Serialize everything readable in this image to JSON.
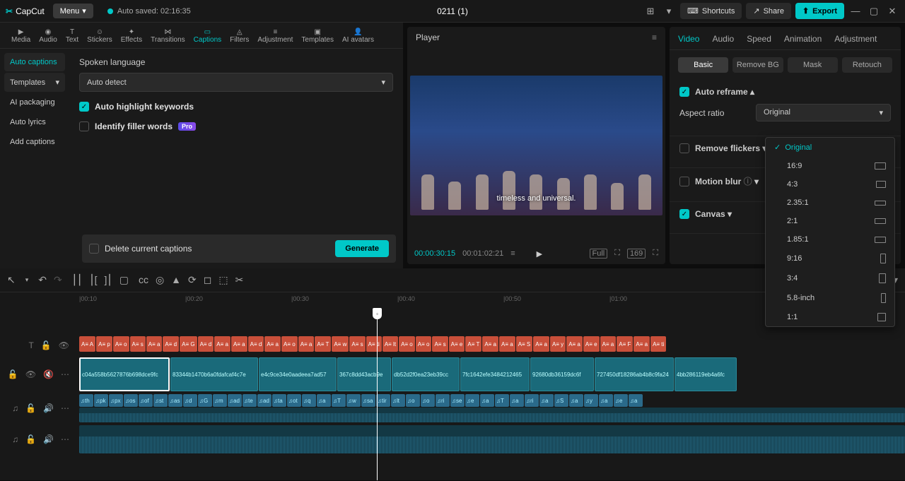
{
  "titlebar": {
    "app": "CapCut",
    "menu": "Menu",
    "autosave": "Auto saved: 02:16:35",
    "project": "0211 (1)",
    "shortcuts": "Shortcuts",
    "share": "Share",
    "export": "Export"
  },
  "toolbar": {
    "media": "Media",
    "audio": "Audio",
    "text": "Text",
    "stickers": "Stickers",
    "effects": "Effects",
    "transitions": "Transitions",
    "captions": "Captions",
    "filters": "Filters",
    "adjustment": "Adjustment",
    "templates": "Templates",
    "avatars": "AI avatars"
  },
  "sidebar": {
    "auto_captions": "Auto captions",
    "templates": "Templates",
    "ai_packaging": "AI packaging",
    "auto_lyrics": "Auto lyrics",
    "add_captions": "Add captions"
  },
  "captions_panel": {
    "lang_label": "Spoken language",
    "lang_value": "Auto detect",
    "highlight": "Auto highlight keywords",
    "filler": "Identify filler words",
    "pro": "Pro",
    "delete": "Delete current captions",
    "generate": "Generate"
  },
  "player": {
    "title": "Player",
    "subtitle": "timeless and universal.",
    "time_cur": "00:00:30:15",
    "time_dur": "00:01:02:21",
    "full": "Full",
    "fit_btn": "169"
  },
  "right": {
    "tabs": {
      "video": "Video",
      "audio": "Audio",
      "speed": "Speed",
      "animation": "Animation",
      "adjustment": "Adjustment"
    },
    "subtabs": {
      "basic": "Basic",
      "removebg": "Remove BG",
      "mask": "Mask",
      "retouch": "Retouch"
    },
    "auto_reframe": "Auto reframe",
    "aspect_label": "Aspect ratio",
    "aspect_value": "Original",
    "remove_flickers": "Remove flickers",
    "motion_blur": "Motion blur",
    "canvas": "Canvas",
    "ratios": [
      "Original",
      "16:9",
      "4:3",
      "2.35:1",
      "2:1",
      "1.85:1",
      "9:16",
      "3:4",
      "5.8-inch",
      "1:1"
    ]
  },
  "timeline": {
    "marks": [
      "00:10",
      "00:20",
      "00:30",
      "00:40",
      "00:50",
      "01:00"
    ],
    "clips": [
      "c04a558b5627876b698dce9fc",
      "83344b1470b6a0fdafcaf4c7e",
      "e4c9ce34e0aadeea7ad57",
      "367c8dd43acb9e",
      "db52d2f0ea23eb39cc",
      "7fc1642efe3484212465",
      "92680db36159dc6f",
      "727450df18286ab4b8c9fa24",
      "4bb286119eb4a6fc"
    ],
    "caption_letters": [
      "A",
      "p",
      "o",
      "s",
      "a",
      "d",
      "G",
      "d",
      "a",
      "a",
      "d",
      "a",
      "o",
      "a",
      "T",
      "w",
      "s",
      "ti",
      "lt",
      "o",
      "o",
      "s",
      "e",
      "T",
      "a",
      "a",
      "S",
      "a",
      "y",
      "a",
      "e",
      "a",
      "F",
      "a",
      "ti"
    ],
    "keywords": [
      "th",
      "pk",
      "px",
      "os",
      "of",
      "st",
      "as",
      "d",
      "G",
      "m",
      "ad",
      "te",
      "ad",
      "ta",
      "ot",
      "q",
      "a",
      "T",
      "w",
      "sa",
      "tir",
      "lt",
      "o",
      "o",
      "ri",
      "se",
      "e",
      "a",
      "T",
      "a",
      "ri",
      "a",
      "S",
      "a",
      "y",
      "a",
      "e",
      "a"
    ]
  }
}
